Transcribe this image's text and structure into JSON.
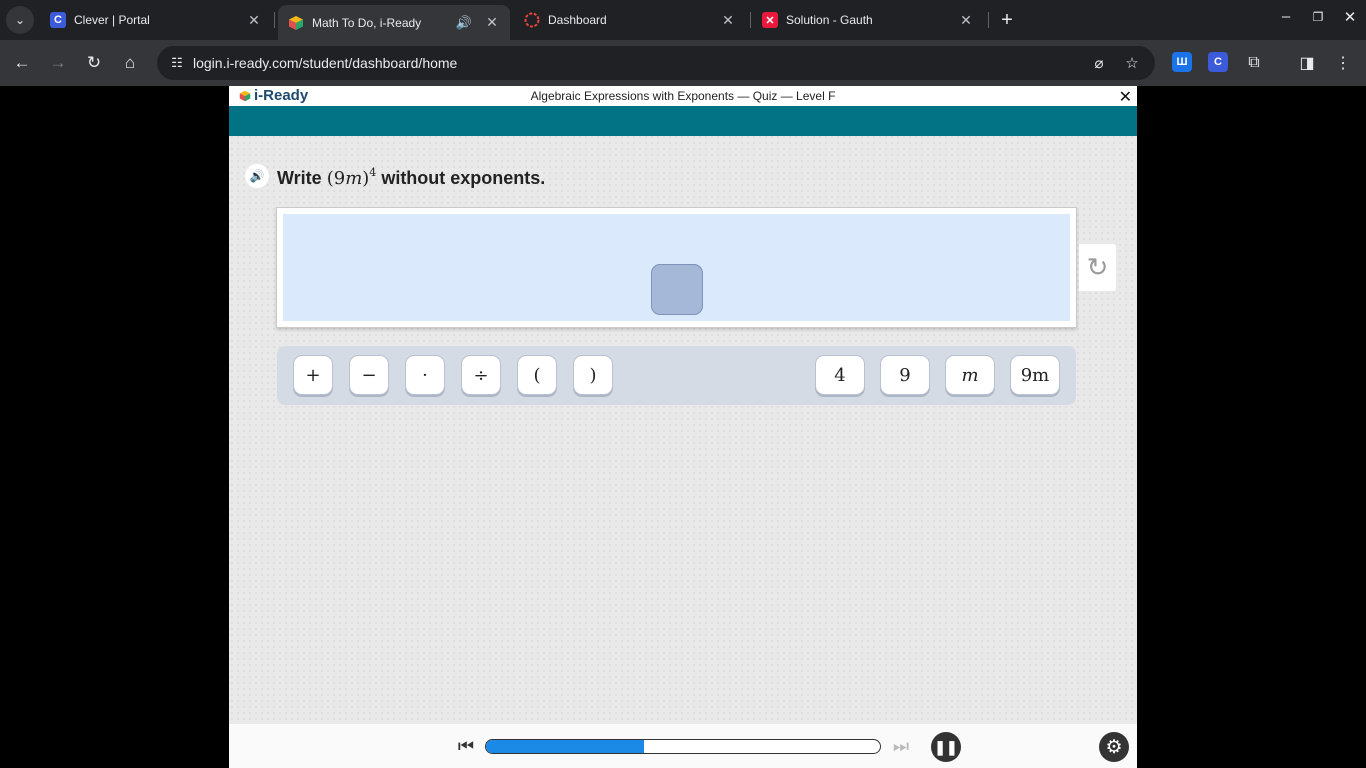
{
  "browser": {
    "tabs": [
      {
        "title": "Clever | Portal",
        "favicon": "clever-icon",
        "color": "#3b5bdb",
        "glyph": "C"
      },
      {
        "title": "Math To Do, i-Ready",
        "favicon": "iready-cube-icon",
        "active": true,
        "audio": true
      },
      {
        "title": "Dashboard",
        "favicon": "dashboard-ring-icon",
        "color": "#e8453c"
      },
      {
        "title": "Solution - Gauth",
        "favicon": "gauth-icon",
        "color": "#e8193c",
        "glyph": "✕"
      }
    ],
    "url": "login.i-ready.com/student/dashboard/home",
    "extensions": [
      {
        "name": "extension-blue-icon",
        "glyph": "Ш",
        "color": "#1a73e8"
      },
      {
        "name": "extension-clever-icon",
        "glyph": "C",
        "color": "#3b5bdb"
      }
    ]
  },
  "app": {
    "brand": "i-Ready",
    "quiz_title": "Algebraic Expressions with Exponents — Quiz — Level F",
    "question": {
      "prefix": "Write",
      "expr_base": "(9",
      "expr_var": "m",
      "expr_close": ")",
      "expr_exp": "4",
      "suffix": "without exponents."
    },
    "operators": [
      "+",
      "−",
      "·",
      "÷",
      "(",
      ")"
    ],
    "values": [
      {
        "text": "4",
        "italic": false
      },
      {
        "text": "9",
        "italic": false
      },
      {
        "text": "m",
        "italic": true
      },
      {
        "text": "9m",
        "italic": false
      }
    ],
    "progress": 0.4,
    "colors": {
      "teal": "#027385",
      "progress": "#1a8ae6",
      "answer_zone": "#dbe9fc"
    }
  }
}
